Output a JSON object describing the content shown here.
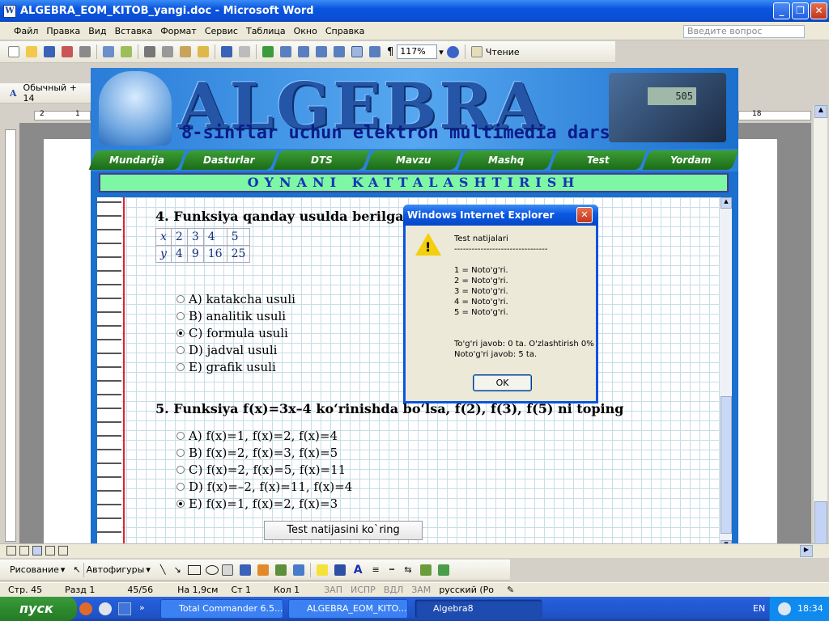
{
  "window": {
    "title": "ALGEBRA_EOM_KITOB_yangi.doc - Microsoft Word"
  },
  "menu": {
    "items": [
      "Файл",
      "Правка",
      "Вид",
      "Вставка",
      "Формат",
      "Сервис",
      "Таблица",
      "Окно",
      "Справка"
    ],
    "ask_placeholder": "Введите вопрос"
  },
  "toolbar": {
    "zoom": "117%",
    "reading": "Чтение",
    "style": "Обычный + 14"
  },
  "ruler": {
    "left_num": "2",
    "mid_num": "1",
    "right_num": "18"
  },
  "app": {
    "title": "ALGEBRA",
    "subtitle": "8-sinflar uchun elektron multimedia darslik",
    "calc_display": "505"
  },
  "nav": [
    "Mundarija",
    "Dasturlar",
    "DTS",
    "Mavzu",
    "Mashq",
    "Test",
    "Yordam"
  ],
  "strip": "OYNANI KATTALASHTIRISH",
  "q4": {
    "title": "4.  Funksiya qanday usulda berilgan:",
    "table": [
      [
        "x",
        "2",
        "3",
        "4",
        "5"
      ],
      [
        "y",
        "4",
        "9",
        "16",
        "25"
      ]
    ],
    "options": [
      {
        "label": "A)  katakcha usuli",
        "checked": false
      },
      {
        "label": "B)  analitik usuli",
        "checked": false
      },
      {
        "label": "C)  formula usuli",
        "checked": true
      },
      {
        "label": "D)  jadval usuli",
        "checked": false
      },
      {
        "label": "E)  grafik usuli",
        "checked": false
      }
    ]
  },
  "q5": {
    "title": "5.  Funksiya f(x)=3x–4 ko‘rinishda bo‘lsa, f(2), f(3), f(5) ni toping",
    "options": [
      {
        "label": "A)  f(x)=1, f(x)=2, f(x)=4",
        "checked": false
      },
      {
        "label": "B)  f(x)=2, f(x)=3, f(x)=5",
        "checked": false
      },
      {
        "label": "C)  f(x)=2, f(x)=5, f(x)=11",
        "checked": false
      },
      {
        "label": "D)  f(x)=–2, f(x)=11, f(x)=4",
        "checked": false
      },
      {
        "label": "E)  f(x)=1, f(x)=2, f(x)=3",
        "checked": true
      }
    ]
  },
  "test_button": "Test natijasini ko`ring",
  "dialog": {
    "title": "Windows Internet Explorer",
    "heading": "Test natijalari",
    "rule": "--------------------------------",
    "lines": [
      "1 = Noto'g'ri.",
      "2 = Noto'g'ri.",
      "3 = Noto'g'ri.",
      "4 = Noto'g'ri.",
      "5 = Noto'g'ri."
    ],
    "summary1": "To'g'ri javob: 0 ta. O'zlashtirish 0%",
    "summary2": "Noto'g'ri javob: 5 ta.",
    "ok": "OK"
  },
  "drawbar": {
    "draw": "Рисование",
    "autoshapes": "Автофигуры"
  },
  "status": {
    "page": "Стр. 45",
    "section": "Разд 1",
    "pages": "45/56",
    "at": "На 1,9см",
    "line": "Ст 1",
    "col": "Кол 1",
    "rec": "ЗАП",
    "trk": "ИСПР",
    "ext": "ВДЛ",
    "ovr": "ЗАМ",
    "lang": "русский (Ро"
  },
  "taskbar": {
    "start": "пуск",
    "tasks": [
      "Total Commander 6.5...",
      "ALGEBRA_EOM_KITO...",
      "Algebra8"
    ],
    "lang": "EN",
    "time": "18:34"
  }
}
